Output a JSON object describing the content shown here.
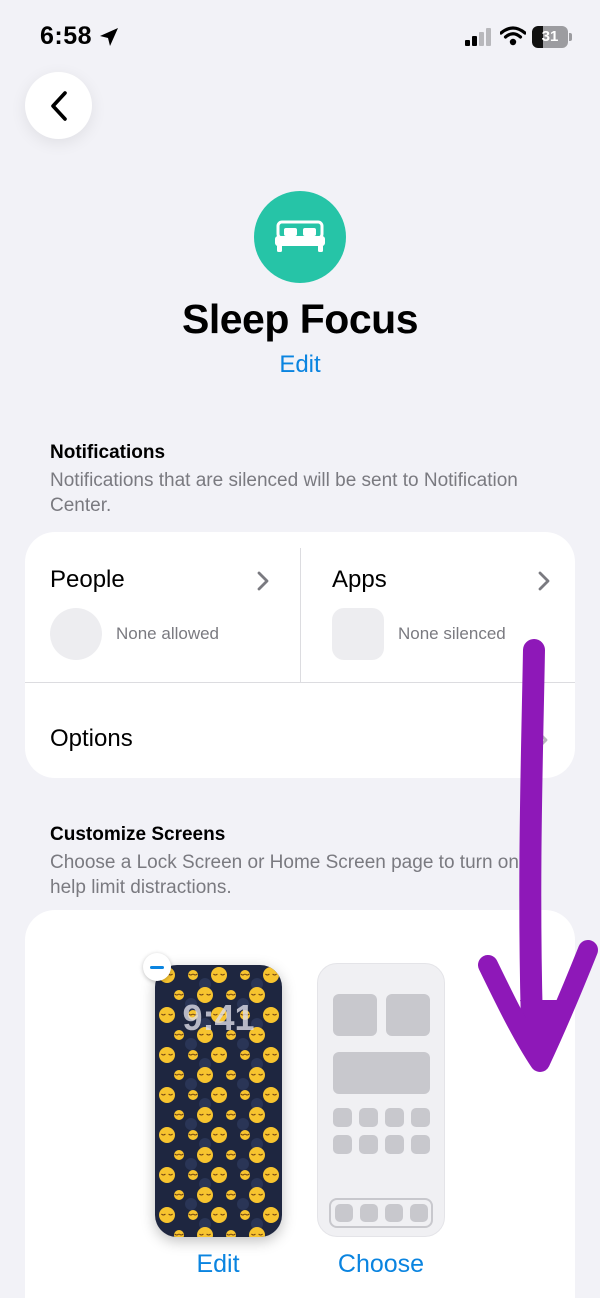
{
  "status_bar": {
    "time": "6:58",
    "battery": "31",
    "battery_level": 0.31
  },
  "header": {
    "title": "Sleep Focus",
    "edit_label": "Edit"
  },
  "notifications": {
    "heading": "Notifications",
    "description": "Notifications that are silenced will be sent to Notification Center.",
    "people": {
      "title": "People",
      "subtitle": "None allowed"
    },
    "apps": {
      "title": "Apps",
      "subtitle": "None silenced"
    },
    "options_label": "Options"
  },
  "customize": {
    "heading": "Customize Screens",
    "description": "Choose a Lock Screen or Home Screen page to turn on to help limit distractions.",
    "lock_screen_time": "9:41",
    "lock_edit_label": "Edit",
    "home_choose_label": "Choose"
  },
  "colors": {
    "accent": "#0a84e0",
    "focus_icon": "#26c4a7",
    "annotation": "#8e18b8"
  },
  "icons": [
    "location-arrow-icon",
    "signal-icon",
    "wifi-icon",
    "battery-icon",
    "back-chevron-icon",
    "bed-icon",
    "chevron-right-icon",
    "minus-icon"
  ]
}
